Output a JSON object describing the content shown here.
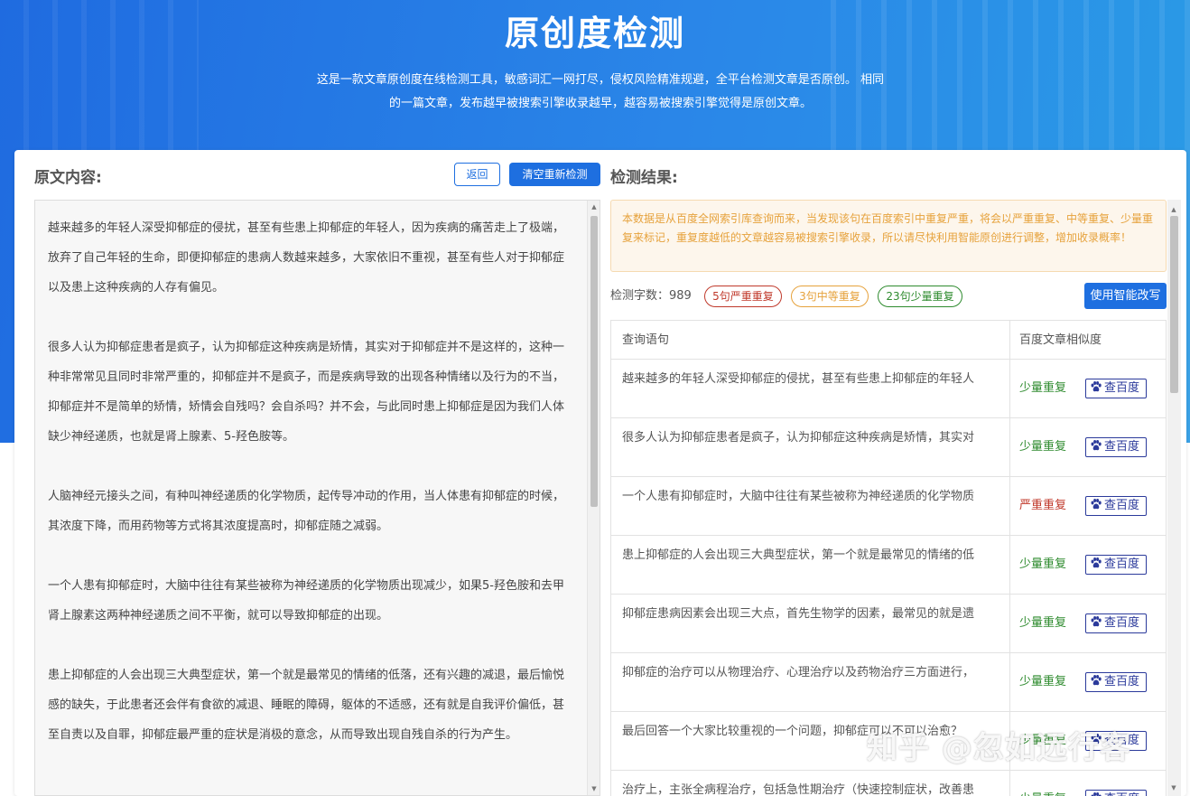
{
  "hero": {
    "title": "原创度检测",
    "desc_line1": "这是一款文章原创度在线检测工具，敏感词汇一网打尽，侵权风险精准规避，全平台检测文章是否原创。 相同",
    "desc_line2": "的一篇文章，发布越早被搜索引擎收录越早，越容易被搜索引擎觉得是原创文章。"
  },
  "left": {
    "title": "原文内容:",
    "back_label": "返回",
    "reset_label": "清空重新检测",
    "paragraphs": [
      "越来越多的年轻人深受抑郁症的侵扰，甚至有些患上抑郁症的年轻人，因为疾病的痛苦走上了极端，放弃了自己年轻的生命，即便抑郁症的患病人数越来越多，大家依旧不重视，甚至有些人对于抑郁症以及患上这种疾病的人存有偏见。",
      "很多人认为抑郁症患者是疯子，认为抑郁症这种疾病是矫情，其实对于抑郁症并不是这样的，这种一种非常常见且同时非常严重的，抑郁症并不是疯子，而是疾病导致的出现各种情绪以及行为的不当，抑郁症并不是简单的矫情，矫情会自残吗？会自杀吗？并不会，与此同时患上抑郁症是因为我们人体缺少神经递质，也就是肾上腺素、5-羟色胺等。",
      "人脑神经元接头之间，有种叫神经递质的化学物质，起传导冲动的作用，当人体患有抑郁症的时候，其浓度下降，而用药物等方式将其浓度提高时，抑郁症随之减弱。",
      "一个人患有抑郁症时，大脑中往往有某些被称为神经递质的化学物质出现减少，如果5-羟色胺和去甲肾上腺素这两种神经递质之间不平衡，就可以导致抑郁症的出现。",
      "患上抑郁症的人会出现三大典型症状，第一个就是最常见的情绪的低落，还有兴趣的减退，最后愉悦感的缺失，于此患者还会伴有食欲的减退、睡眠的障碍，躯体的不适感，还有就是自我评价偏低，甚至自责以及自罪，抑郁症最严重的症状是消极的意念，从而导致出现自残自杀的行为产生。"
    ]
  },
  "right": {
    "title": "检测结果:",
    "notice": "本数据是从百度全网索引库查询而来，当发现该句在百度索引中重复严重，将会以严重重复、中等重复、少量重复来标记，重复度越低的文章越容易被搜索引擎收录，所以请尽快利用智能原创进行调整，增加收录概率！",
    "stats_label": "检测字数：989",
    "tag_severe": "5句严重重复",
    "tag_medium": "3句中等重复",
    "tag_light": "23句少量重复",
    "rewrite_label": "使用智能改写",
    "col_sentence": "查询语句",
    "col_similarity": "百度文章相似度",
    "check_label": "查百度",
    "rows": [
      {
        "sentence": "越来越多的年轻人深受抑郁症的侵扰，甚至有些患上抑郁症的年轻人",
        "level": "少量重复",
        "level_color": "#2e8b2e"
      },
      {
        "sentence": "很多人认为抑郁症患者是疯子，认为抑郁症这种疾病是矫情，其实对",
        "level": "少量重复",
        "level_color": "#2e8b2e"
      },
      {
        "sentence": "一个人患有抑郁症时，大脑中往往有某些被称为神经递质的化学物质",
        "level": "严重重复",
        "level_color": "#c0392b"
      },
      {
        "sentence": "患上抑郁症的人会出现三大典型症状，第一个就是最常见的情绪的低",
        "level": "少量重复",
        "level_color": "#2e8b2e"
      },
      {
        "sentence": "抑郁症患病因素会出现三大点，首先生物学的因素，最常见的就是遗",
        "level": "少量重复",
        "level_color": "#2e8b2e"
      },
      {
        "sentence": "抑郁症的治疗可以从物理治疗、心理治疗以及药物治疗三方面进行，",
        "level": "少量重复",
        "level_color": "#2e8b2e"
      },
      {
        "sentence": "最后回答一个大家比较重视的一个问题，抑郁症可以不可以治愈？",
        "level": "少量重复",
        "level_color": "#2e8b2e"
      },
      {
        "sentence": "治疗上，主张全病程治疗，包括急性期治疗（快速控制症状，改善患",
        "level": "少量重复",
        "level_color": "#2e8b2e"
      }
    ]
  },
  "watermark": "知乎 @忽如远行客",
  "colors": {
    "accent": "#1e6fe0",
    "severe": "#c0392b",
    "medium": "#e6a23c",
    "light": "#2e8b2e"
  }
}
